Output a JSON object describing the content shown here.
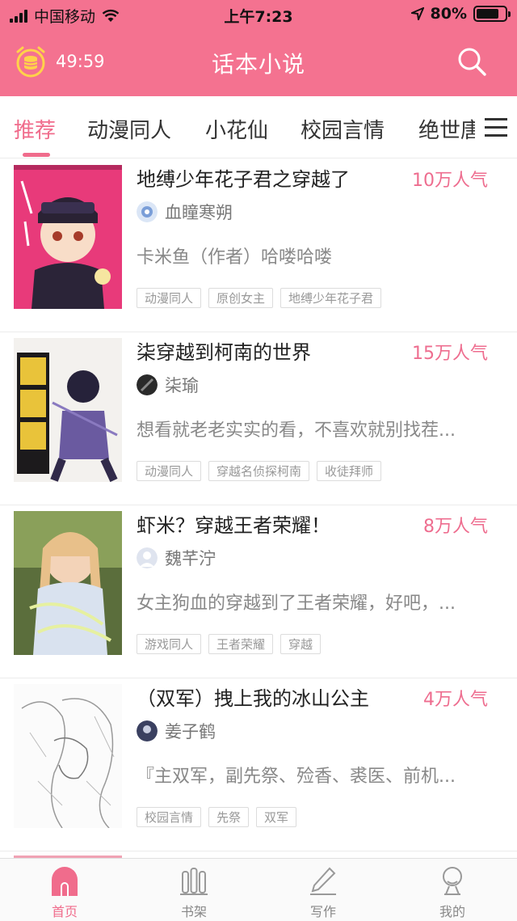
{
  "status_bar": {
    "carrier": "中国移动",
    "time": "上午7:23",
    "battery": "80%",
    "battery_level": 0.8
  },
  "header": {
    "timer": "49:59",
    "title": "话本小说"
  },
  "colors": {
    "brand_pink": "#f47290",
    "accent": "#f06c8c"
  },
  "tabs": [
    {
      "label": "推荐",
      "active": true
    },
    {
      "label": "动漫同人"
    },
    {
      "label": "小花仙"
    },
    {
      "label": "校园言情"
    },
    {
      "label": "绝世唐"
    }
  ],
  "books": [
    {
      "title": "地缚少年花子君之穿越了",
      "popularity": "10万人气",
      "author": "血瞳寒朔",
      "desc": "卡米鱼（作者）哈喽哈喽",
      "tags": [
        "动漫同人",
        "原创女主",
        "地缚少年花子君"
      ]
    },
    {
      "title": "柒穿越到柯南的世界",
      "popularity": "15万人气",
      "author": "柒瑜",
      "desc": "想看就老老实实的看，不喜欢就别找茬...",
      "tags": [
        "动漫同人",
        "穿越名侦探柯南",
        "收徒拜师"
      ]
    },
    {
      "title": "虾米？穿越王者荣耀！",
      "popularity": "8万人气",
      "author": "魏芊泞",
      "desc": "女主狗血的穿越到了王者荣耀，好吧，...",
      "tags": [
        "游戏同人",
        "王者荣耀",
        "穿越"
      ]
    },
    {
      "title": "（双军）拽上我的冰山公主",
      "popularity": "4万人气",
      "author": "姜子鹤",
      "desc": "『主双军，副先祭、殓香、裘医、前机...",
      "tags": [
        "校园言情",
        "先祭",
        "双军"
      ]
    }
  ],
  "bottom_nav": [
    {
      "label": "首页",
      "icon": "home-icon",
      "active": true
    },
    {
      "label": "书架",
      "icon": "bookshelf-icon"
    },
    {
      "label": "写作",
      "icon": "pen-icon"
    },
    {
      "label": "我的",
      "icon": "profile-icon"
    }
  ]
}
